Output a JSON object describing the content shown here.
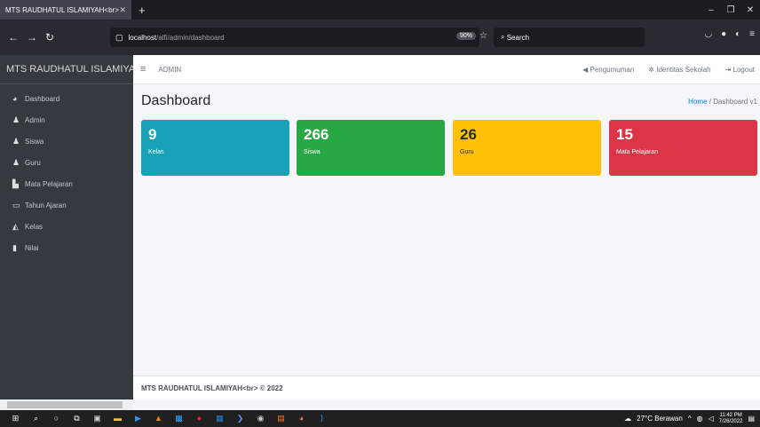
{
  "browser": {
    "tab_title": "MTS RAUDHATUL ISLAMIYAH<br>",
    "url_host": "localhost",
    "url_path": "/alfi/admin/dashboard",
    "zoom": "90%",
    "search_placeholder": "Search"
  },
  "app": {
    "brand": "MTS RAUDHATUL ISLAMIYAH",
    "user_label": "ADMIN",
    "top_links": [
      "Pengumuman",
      "Identitas Sekolah",
      "Logout"
    ]
  },
  "sidebar": {
    "items": [
      {
        "label": "Dashboard",
        "icon": "tachometer-icon"
      },
      {
        "label": "Admin",
        "icon": "user-icon"
      },
      {
        "label": "Siswa",
        "icon": "users-icon"
      },
      {
        "label": "Guru",
        "icon": "users-icon"
      },
      {
        "label": "Mata Pelajaran",
        "icon": "book-icon"
      },
      {
        "label": "Tahun Ajaran",
        "icon": "calendar-icon"
      },
      {
        "label": "Kelas",
        "icon": "chalkboard-icon"
      },
      {
        "label": "Nilai",
        "icon": "file-icon"
      }
    ]
  },
  "page": {
    "title": "Dashboard",
    "breadcrumb_home": "Home",
    "breadcrumb_current": "Dashboard v1"
  },
  "stats": [
    {
      "value": "9",
      "label": "Kelas",
      "color": "#17a2b8"
    },
    {
      "value": "266",
      "label": "Siswa",
      "color": "#28a745"
    },
    {
      "value": "26",
      "label": "Guru",
      "color": "#ffc107"
    },
    {
      "value": "15",
      "label": "Mata Pelajaran",
      "color": "#dc3545"
    }
  ],
  "footer": {
    "text": "MTS RAUDHATUL ISLAMIYAH<br> © 2022"
  },
  "taskbar": {
    "weather": "27°C  Berawan",
    "time": "11:42 PM",
    "date": "7/26/2022"
  }
}
